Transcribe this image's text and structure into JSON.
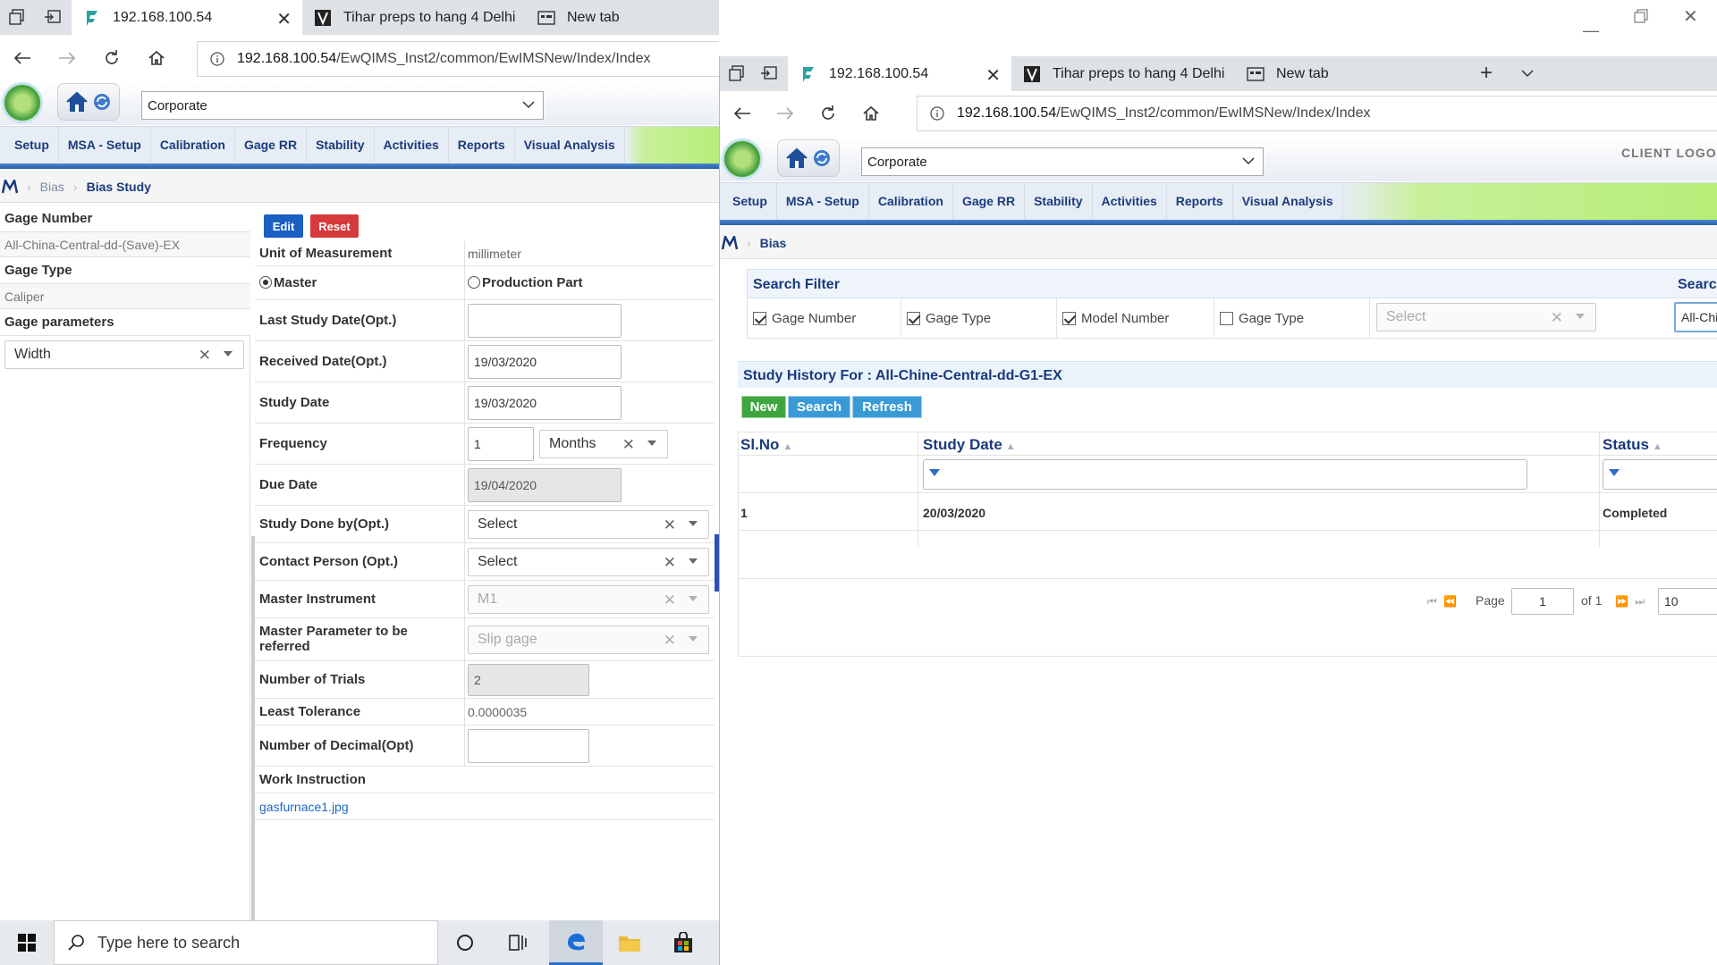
{
  "left_browser": {
    "tabs": [
      {
        "title": "192.168.100.54",
        "active": true
      },
      {
        "title": "Tihar preps to hang 4 Delhi"
      },
      {
        "title": "New tab"
      }
    ],
    "address_host": "192.168.100.54",
    "address_path": "/EwQIMS_Inst2/common/EwIMSNew/Index/Index"
  },
  "right_browser": {
    "tabs": [
      {
        "title": "192.168.100.54",
        "active": true
      },
      {
        "title": "Tihar preps to hang 4 Delhi"
      },
      {
        "title": "New tab"
      }
    ],
    "address_host": "192.168.100.54",
    "address_path": "/EwQIMS_Inst2/common/EwIMSNew/Index/Index"
  },
  "app": {
    "org_select": "Corporate",
    "client_logo": "CLIENT LOGO",
    "nav": [
      "Setup",
      "MSA - Setup",
      "Calibration",
      "Gage RR",
      "Stability",
      "Activities",
      "Reports",
      "Visual Analysis"
    ]
  },
  "left_page": {
    "breadcrumb": [
      "Bias",
      "Bias Study"
    ],
    "gage_number_label": "Gage Number",
    "gage_number_value": "All-China-Central-dd-(Save)-EX",
    "gage_type_label": "Gage Type",
    "gage_type_value": "Caliper",
    "gage_params_label": "Gage parameters",
    "gage_params_value": "Width",
    "edit_button": "Edit",
    "reset_button": "Reset",
    "form": {
      "uom_label": "Unit of Measurement",
      "uom_value": "millimeter",
      "master_radio": "Master",
      "production_radio": "Production Part",
      "last_study_label": "Last Study Date(Opt.)",
      "last_study_value": "",
      "received_label": "Received Date(Opt.)",
      "received_value": "19/03/2020",
      "study_date_label": "Study Date",
      "study_date_value": "19/03/2020",
      "frequency_label": "Frequency",
      "frequency_value": "1",
      "frequency_unit": "Months",
      "due_date_label": "Due Date",
      "due_date_value": "19/04/2020",
      "study_done_label": "Study Done by(Opt.)",
      "study_done_value": "Select",
      "contact_label": "Contact Person (Opt.)",
      "contact_value": "Select",
      "master_instr_label": "Master Instrument",
      "master_instr_value": "M1",
      "master_param_label_1": "Master Parameter to be",
      "master_param_label_2": "referred",
      "master_param_value": "Slip gage",
      "trials_label": "Number of Trials",
      "trials_value": "2",
      "least_tol_label": "Least Tolerance",
      "least_tol_value": "0.0000035",
      "decimal_label": "Number of Decimal(Opt)",
      "decimal_value": "",
      "work_instr_label": "Work Instruction",
      "work_instr_link": "gasfurnace1.jpg"
    }
  },
  "right_page": {
    "breadcrumb": [
      "Bias"
    ],
    "search_filter_title": "Search Filter",
    "search_title_2": "Search",
    "filters": [
      {
        "label": "Gage Number",
        "checked": true
      },
      {
        "label": "Gage Type",
        "checked": true
      },
      {
        "label": "Model Number",
        "checked": true
      },
      {
        "label": "Gage Type",
        "checked": false
      }
    ],
    "filter_select": "Select",
    "search_value": "All-Chi",
    "history_title": "Study History For : All-Chine-Central-dd-G1-EX",
    "buttons": {
      "new": "New",
      "search": "Search",
      "refresh": "Refresh"
    },
    "columns": [
      "Sl.No",
      "Study Date",
      "Status"
    ],
    "rows": [
      {
        "slno": "1",
        "study_date": "20/03/2020",
        "status": "Completed"
      }
    ],
    "pager": {
      "page_label": "Page",
      "page": "1",
      "of_label": "of 1",
      "page_size": "10"
    }
  },
  "taskbar": {
    "search_placeholder": "Type here to search"
  }
}
